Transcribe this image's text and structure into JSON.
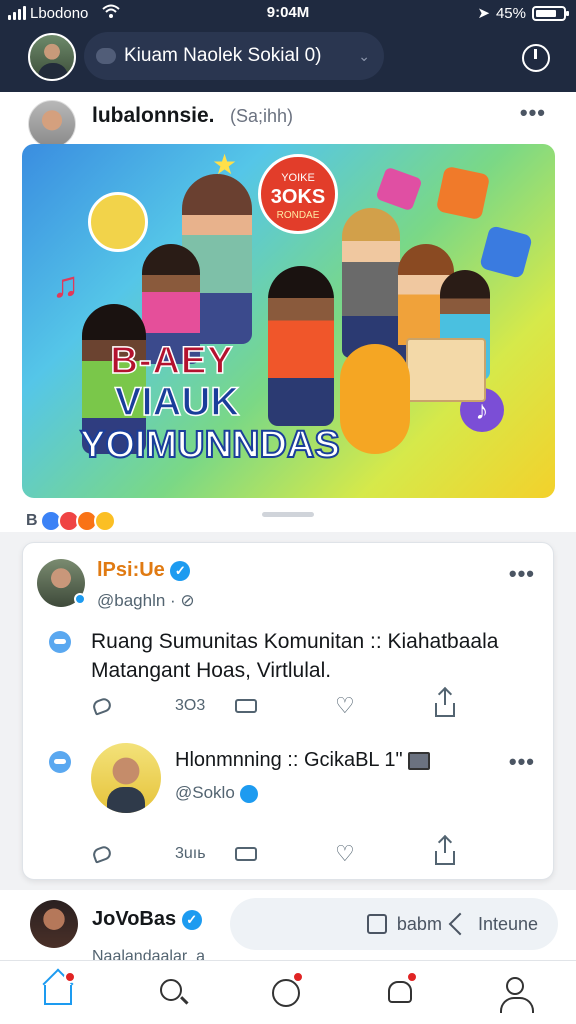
{
  "status_bar": {
    "carrier": "Lbodono",
    "time": "9:04M",
    "battery": "45%"
  },
  "header": {
    "title": "Kiuam Naolek Sokial 0)",
    "dropdown": "⌄"
  },
  "post1": {
    "author": "lubalonnsie.",
    "handle": "(Sa;ihh)",
    "hero": {
      "badge_top": "YOIKE",
      "badge_main": "3OKS",
      "badge_sub": "RONDAE",
      "line1": "B-AEY",
      "line2": "VIAUK",
      "line3": "YOIMUNNDAS"
    },
    "reaction_label": "B"
  },
  "card": {
    "tweet1": {
      "name": "lPsi:Ue",
      "handle": "@baghln · ⊘",
      "text_line1": "Ruang Sumunitas Komunitan :: Kiahatbaala",
      "text_line2": "Matangant Hoas, Virtlulal.",
      "reply_count": "",
      "retweet_count": "3O3",
      "like_count": ""
    },
    "tweet2": {
      "name": "Hlonmnning :: GcikaBL 1\"",
      "handle": "@Soklo",
      "retweet_count": "3uıь"
    }
  },
  "post3": {
    "author": "JoVoBas",
    "sub": "Naalandaalar_a",
    "button_label_1": "babm",
    "button_label_2": "Inteune"
  },
  "colors": {
    "accent": "#1d9bf0",
    "header_bg": "#1f2a40",
    "badge": "#e02424"
  }
}
